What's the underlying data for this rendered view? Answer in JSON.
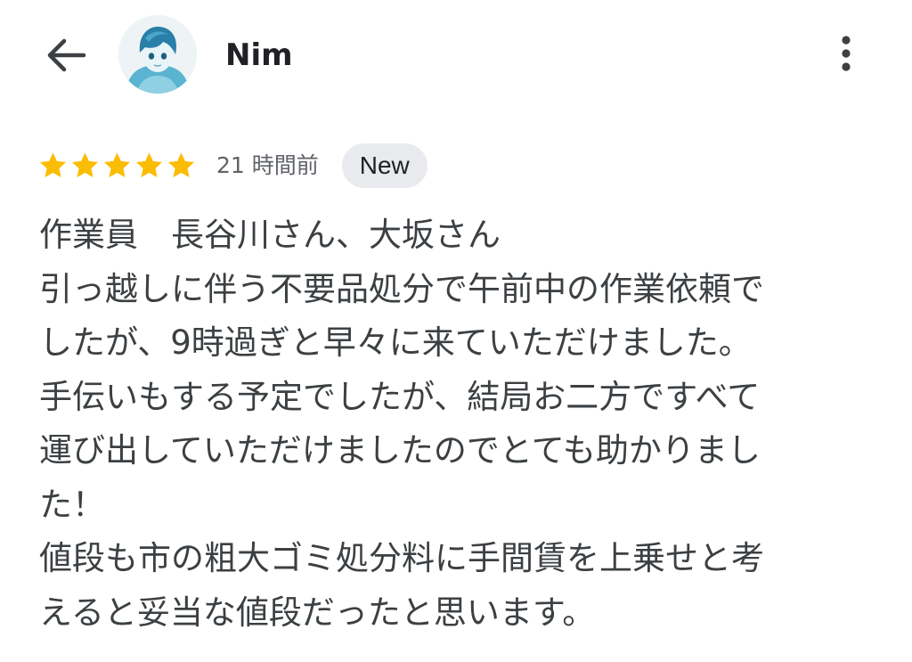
{
  "header": {
    "user_name": "Nim",
    "avatar_icon": "anime-avatar-icon",
    "back_icon": "arrow-left-icon",
    "more_icon": "more-vert-icon"
  },
  "review": {
    "rating": 5,
    "max_rating": 5,
    "star_color": "#fbbc04",
    "time_ago": "21 時間前",
    "badge": "New",
    "lines": [
      "作業員　長谷川さん、大坂さん",
      "引っ越しに伴う不要品処分で午前中の作業依頼で",
      "したが、9時過ぎと早々に来ていただけました。",
      "手伝いもする予定でしたが、結局お二方ですべて",
      "運び出していただけましたのでとても助かりまし",
      "た！",
      "値段も市の粗大ゴミ処分料に手間賃を上乗せと考",
      "えると妥当な値段だったと思います。"
    ]
  }
}
